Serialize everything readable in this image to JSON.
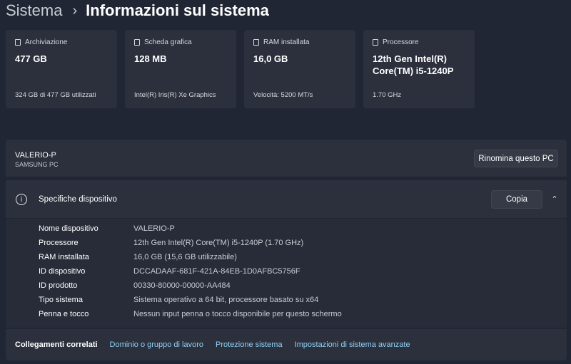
{
  "breadcrumb": {
    "parent": "Sistema",
    "separator": "›",
    "current": "Informazioni sul sistema"
  },
  "cards": [
    {
      "icon": "storage-icon",
      "title": "Archiviazione",
      "value": "477 GB",
      "sub": "324 GB di 477 GB utilizzati"
    },
    {
      "icon": "gpu-icon",
      "title": "Scheda grafica",
      "value": "128 MB",
      "sub": "Intel(R) Iris(R) Xe Graphics"
    },
    {
      "icon": "ram-icon",
      "title": "RAM installata",
      "value": "16,0 GB",
      "sub": "Velocità: 5200 MT/s"
    },
    {
      "icon": "processor-icon",
      "title": "Processore",
      "value": "12th Gen Intel(R) Core(TM) i5-1240P",
      "sub": "1.70 GHz"
    }
  ],
  "device": {
    "name": "VALERIO-P",
    "model": "SAMSUNG PC",
    "rename_label": "Rinomina questo PC"
  },
  "specs": {
    "title": "Specifiche dispositivo",
    "copy_label": "Copia",
    "info_glyph": "i",
    "chevron_glyph": "⌃",
    "rows": [
      {
        "label": "Nome dispositivo",
        "value": "VALERIO-P"
      },
      {
        "label": "Processore",
        "value": "12th Gen Intel(R) Core(TM) i5-1240P (1.70 GHz)"
      },
      {
        "label": "RAM installata",
        "value": "16,0 GB (15,6 GB utilizzabile)"
      },
      {
        "label": "ID dispositivo",
        "value": "DCCADAAF-681F-421A-84EB-1D0AFBC5756F"
      },
      {
        "label": "ID prodotto",
        "value": "00330-80000-00000-AA484"
      },
      {
        "label": "Tipo sistema",
        "value": "Sistema operativo a 64 bit, processore basato su x64"
      },
      {
        "label": "Penna e tocco",
        "value": "Nessun input penna o tocco disponibile per questo schermo"
      }
    ]
  },
  "related": {
    "title": "Collegamenti correlati",
    "links": [
      "Dominio o gruppo di lavoro",
      "Protezione sistema",
      "Impostazioni di sistema avanzate"
    ]
  },
  "colors": {
    "background": "#202633",
    "panel": "#2b303c",
    "link": "#8fd1f7"
  }
}
